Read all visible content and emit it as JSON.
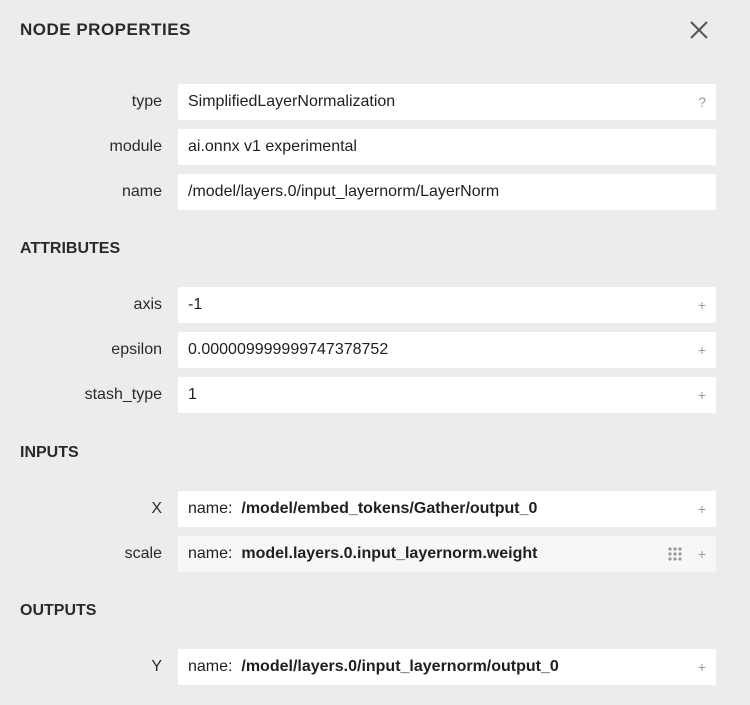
{
  "panel": {
    "title": "NODE PROPERTIES"
  },
  "properties": {
    "type_label": "type",
    "type_value": "SimplifiedLayerNormalization",
    "type_help": "?",
    "module_label": "module",
    "module_value": "ai.onnx v1 experimental",
    "name_label": "name",
    "name_value": "/model/layers.0/input_layernorm/LayerNorm"
  },
  "attributes": {
    "heading": "ATTRIBUTES",
    "items": [
      {
        "label": "axis",
        "value": "-1",
        "expand": "+"
      },
      {
        "label": "epsilon",
        "value": "0.000009999999747378752",
        "expand": "+"
      },
      {
        "label": "stash_type",
        "value": "1",
        "expand": "+"
      }
    ]
  },
  "inputs": {
    "heading": "INPUTS",
    "items": [
      {
        "label": "X",
        "prefix": "name:",
        "value": "/model/embed_tokens/Gather/output_0",
        "expand": "+"
      },
      {
        "label": "scale",
        "prefix": "name:",
        "value": "model.layers.0.input_layernorm.weight",
        "expand": "+"
      }
    ]
  },
  "outputs": {
    "heading": "OUTPUTS",
    "items": [
      {
        "label": "Y",
        "prefix": "name:",
        "value": "/model/layers.0/input_layernorm/output_0",
        "expand": "+"
      }
    ]
  },
  "icons": {
    "close": "close-icon",
    "grip": "grid-dots-icon"
  }
}
